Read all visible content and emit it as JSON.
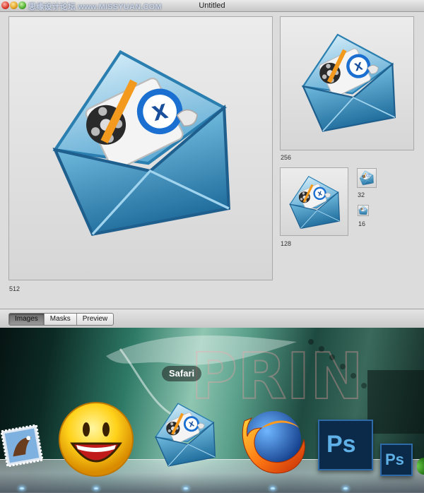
{
  "window": {
    "title": "Untitled",
    "watermark": "思缘设计论坛 www.MISSYUAN.COM"
  },
  "previews": {
    "size_512": "512",
    "size_256": "256",
    "size_128": "128",
    "size_32": "32",
    "size_16": "16"
  },
  "tabs": [
    {
      "label": "Images",
      "active": true
    },
    {
      "label": "Masks",
      "active": false
    },
    {
      "label": "Preview",
      "active": false
    }
  ],
  "dock": {
    "tooltip": "Safari",
    "ps_label_large": "Ps",
    "ps_label_small": "Ps",
    "backdrop_text": "PRIN"
  },
  "colors": {
    "envelope": "#2e86b8",
    "envelope_light": "#8ccbe6",
    "photoshop": "#0b2a4a",
    "photoshop_text": "#5fb0e6"
  }
}
